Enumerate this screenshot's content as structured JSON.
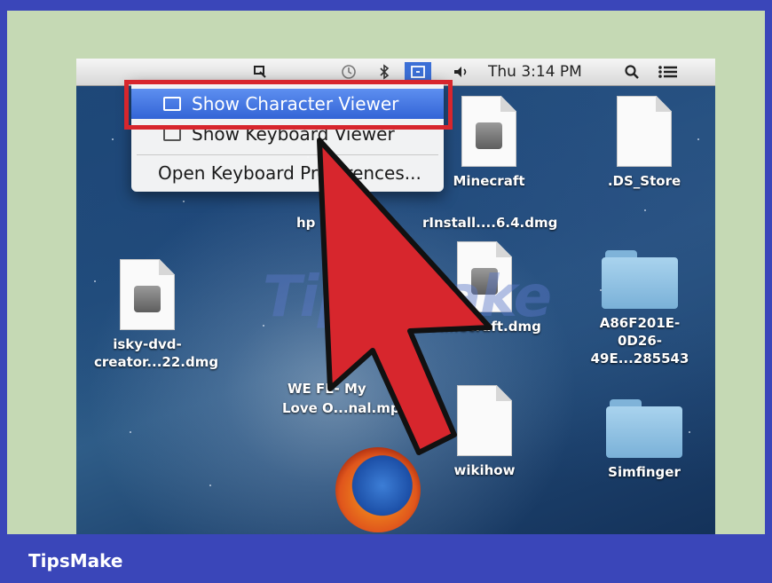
{
  "footer": {
    "brand": "TipsMake"
  },
  "menubar": {
    "clock": "Thu 3:14 PM",
    "icons": [
      "screen-capture-icon",
      "time-machine-icon",
      "bluetooth-icon",
      "input-menu-icon",
      "volume-icon",
      "spotlight-search-icon",
      "notification-center-icon"
    ]
  },
  "input_menu": {
    "items": [
      {
        "label": "Show Character Viewer",
        "selected": true
      },
      {
        "label": "Show Keyboard Viewer",
        "selected": false
      },
      {
        "label": "Open Keyboard Preferences...",
        "selected": false
      }
    ]
  },
  "desktop": {
    "items": [
      {
        "name": "Minecraft",
        "icon": "dmg-file-icon"
      },
      {
        "name": ".DS_Store",
        "icon": "document-icon"
      },
      {
        "name": "isky-dvd-creator...22.dmg",
        "icon": "dmg-file-icon"
      },
      {
        "name": "Minecraft.dmg",
        "icon": "dmg-file-icon"
      },
      {
        "name": "A86F201E-0D26-49E...285543",
        "icon": "folder-icon"
      },
      {
        "name": "wikihow",
        "icon": "document-icon"
      },
      {
        "name": "Simfinger",
        "icon": "folder-icon"
      }
    ],
    "partial_labels": {
      "installer": "rInstall....6.4.dmg",
      "installer_prefix": "hp",
      "video_line1": "WE     FE- My",
      "video_line2": "Love O...nal.mp4"
    }
  },
  "watermark": "TipsMake",
  "colors": {
    "frame": "#3a46b9",
    "panel": "#c5d9b4",
    "highlight": "#d7262d",
    "arrow": "#d7262d",
    "menu_selection": "#3b6fd6"
  }
}
